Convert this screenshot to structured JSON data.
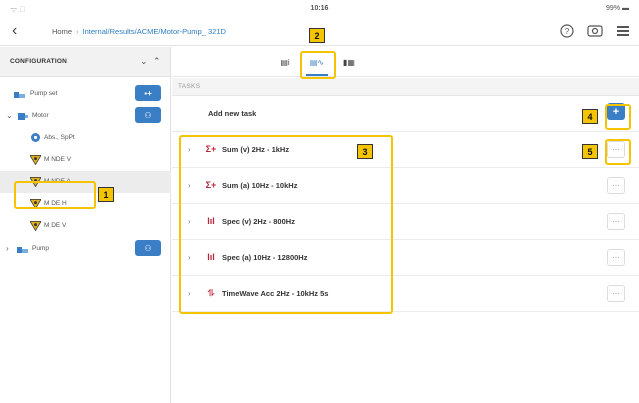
{
  "status": {
    "left": "ᯤ ᪲",
    "time": "10:16",
    "battery": "99% ▬"
  },
  "nav": {
    "back_glyph": "‹",
    "home": "Home",
    "separator": "›",
    "path": "Internal/Results/ACME/Motor-Pump_ 321D",
    "icons": [
      "help-icon",
      "camera-sensor-icon",
      "menu-icon"
    ]
  },
  "sidebar": {
    "title": "CONFIGURATION",
    "collapse_glyph": "⌄",
    "expand_glyph": "⌃",
    "items": [
      {
        "label": "Pump set",
        "pill": "▪+"
      },
      {
        "label": "Motor",
        "pill": "⚇",
        "caret": "⌄"
      },
      {
        "label": "Abs., SpPt"
      },
      {
        "label": "M NDE V"
      },
      {
        "label": "M NDE A"
      },
      {
        "label": "M DE H"
      },
      {
        "label": "M DE V"
      },
      {
        "label": "Pump",
        "pill": "⚇",
        "caret": "›"
      }
    ]
  },
  "main": {
    "section_label": "TASKS",
    "add_label": "Add new task",
    "add_glyph": "+",
    "more_glyph": "···",
    "caret_glyph": "›",
    "tasks": [
      {
        "label": "Sum (v) 2Hz - 1kHz",
        "icon": "Σ+"
      },
      {
        "label": "Sum (a) 10Hz - 10kHz",
        "icon": "Σ+"
      },
      {
        "label": "Spec (v) 2Hz - 800Hz",
        "icon": "lıl"
      },
      {
        "label": "Spec (a) 10Hz - 12800Hz",
        "icon": "lıl"
      },
      {
        "label": "TimeWave Acc 2Hz - 10kHz 5s",
        "icon": "⥮"
      }
    ]
  },
  "tabs": [
    {
      "name": "tab-info",
      "glyph": "▤i"
    },
    {
      "name": "tab-tasks",
      "glyph": "▤∿"
    },
    {
      "name": "tab-overview",
      "glyph": "▮▦"
    }
  ],
  "callouts": [
    "1",
    "2",
    "3",
    "4",
    "5"
  ],
  "colors": {
    "accent": "#3a7fc6",
    "highlight": "#f5c400",
    "task_icon": "#b8263a"
  }
}
